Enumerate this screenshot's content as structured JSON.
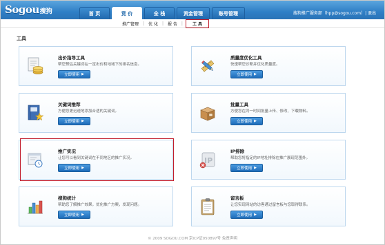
{
  "header": {
    "logo_text": "Sogou",
    "logo_sub": "搜狗",
    "tabs": [
      {
        "label": "首 页"
      },
      {
        "label": "竞 价"
      },
      {
        "label": "全 栈"
      },
      {
        "label": "资金管理"
      },
      {
        "label": "账号管理"
      }
    ],
    "user_info": "搜狗推广服务部（hpp@sogou.com）| 退出"
  },
  "subnav": {
    "items": [
      {
        "label": "推广管理"
      },
      {
        "label": "优 化"
      },
      {
        "label": "报 告"
      },
      {
        "label": "工 具"
      }
    ]
  },
  "page_title": "工具",
  "cards": [
    {
      "title": "出价指导工具",
      "desc": "帮您预估关键词在一定出价和地域下的排名信息。",
      "button": "立即使用",
      "icon": "coins-document-icon"
    },
    {
      "title": "质量度优化工具",
      "desc": "快速帮您诊断并优化质量度。",
      "button": "立即使用",
      "icon": "pencil-ruler-icon"
    },
    {
      "title": "关键词推荐",
      "desc": "方便您更迅速地添加合适的关键词。",
      "button": "立即使用",
      "icon": "book-star-icon"
    },
    {
      "title": "批量工具",
      "desc": "方便您在同一时间批量上传、修改、下载物料。",
      "button": "立即使用",
      "icon": "boxes-icon"
    },
    {
      "title": "推广实况",
      "desc": "让您可以看到关键词在不同地区的推广实况。",
      "button": "立即使用",
      "icon": "monitor-clock-icon"
    },
    {
      "title": "IP排除",
      "desc": "帮助您将指定的IP地址排除在推广展现范围外。",
      "button": "立即使用",
      "icon": "ip-block-icon"
    },
    {
      "title": "搜狗统计",
      "desc": "帮助您了解推广效果，优化推广方案，发现问题。",
      "button": "立即使用",
      "icon": "bar-chart-icon"
    },
    {
      "title": "留言板",
      "desc": "让您实现网站的访客通过留言板与您取得联系。",
      "button": "立即使用",
      "icon": "clipboard-icon"
    }
  ],
  "footer": "© 2009 SOGOU.COM 京ICP证050897号 免责声明"
}
